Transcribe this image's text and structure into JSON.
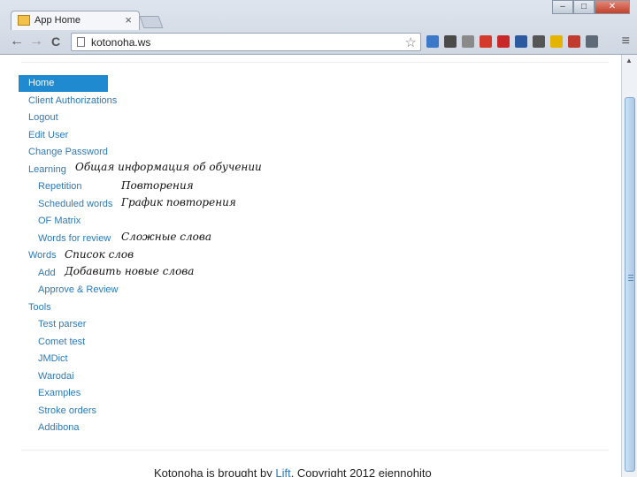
{
  "browser": {
    "tab_title": "App Home",
    "tab_close": "×",
    "url": "kotonoha.ws",
    "back": "←",
    "forward": "→",
    "reload": "C",
    "star": "☆",
    "menu": "≡",
    "window_buttons": [
      "–",
      "□",
      "✕"
    ],
    "extension_colors": [
      "#3b78c8",
      "#4a4a4a",
      "#8a8a8a",
      "#d33a2c",
      "#c8282a",
      "#2c5aa0",
      "#555555",
      "#e4b400",
      "#c23b2f",
      "#5e6a78"
    ]
  },
  "nav": {
    "home": "Home",
    "client_authorizations": "Client Authorizations",
    "logout": "Logout",
    "edit_user": "Edit User",
    "change_password": "Change Password",
    "learning": "Learning",
    "repetition": "Repetition",
    "scheduled_words": "Scheduled words",
    "of_matrix": "OF Matrix",
    "words_for_review": "Words for review",
    "words": "Words",
    "add": "Add",
    "approve_review": "Approve & Review",
    "tools": "Tools",
    "test_parser": "Test parser",
    "comet_test": "Comet test",
    "jmdict": "JMDict",
    "warodai": "Warodai",
    "examples": "Examples",
    "stroke_orders": "Stroke orders",
    "addibona": "Addibona"
  },
  "annotations": {
    "learning": "Общая информация об обучении",
    "repetition": "Повторения",
    "scheduled_words": "График повторения",
    "words_for_review": "Сложные слова",
    "words": "Список слов",
    "add": "Добавить новые слова"
  },
  "footer": {
    "prefix": "Kotonoha is brought by",
    "link": "Lift",
    "suffix": ". Copyright 2012 eiennohito"
  }
}
